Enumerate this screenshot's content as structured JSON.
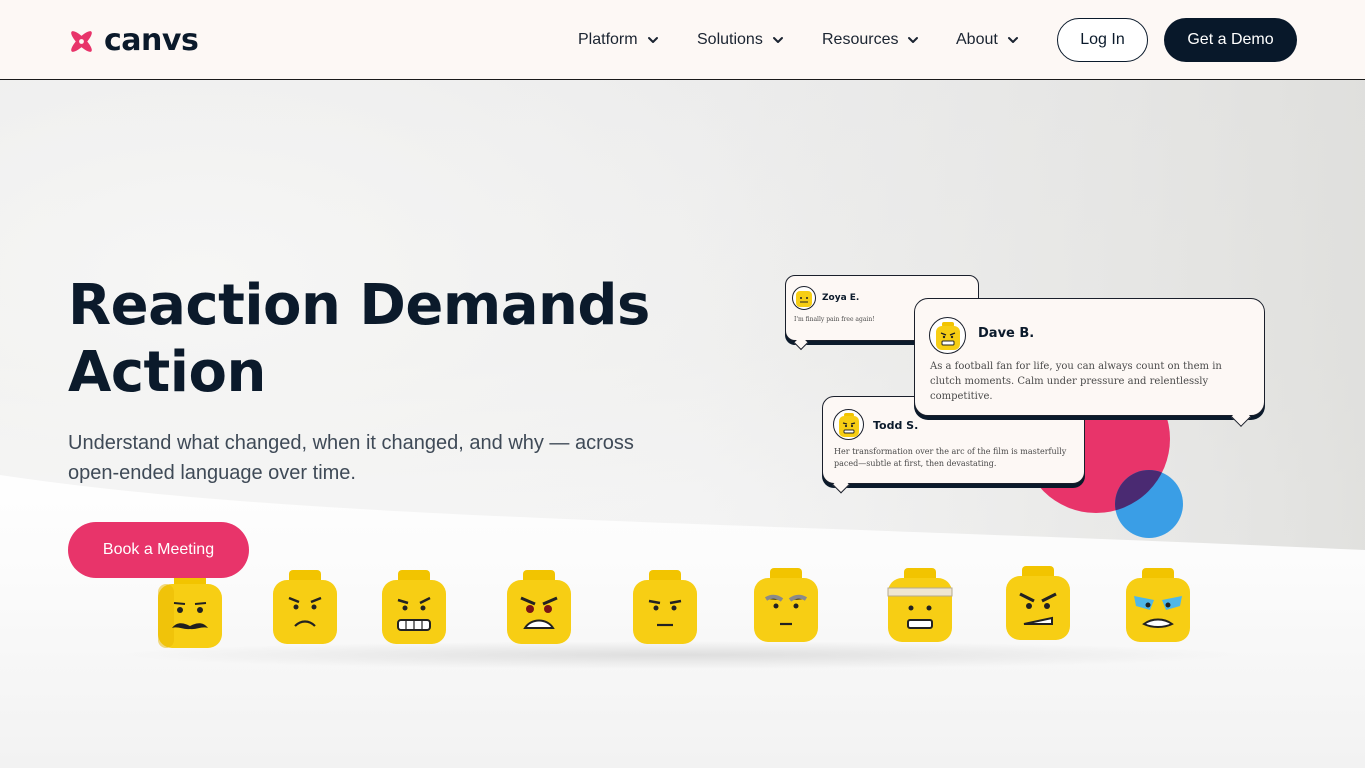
{
  "brand": {
    "name": "canvs",
    "accent": "#e8346a",
    "dark": "#08182a",
    "blue": "#3a9ee6"
  },
  "nav": {
    "items": [
      {
        "label": "Platform",
        "icon": "chevron-down-icon"
      },
      {
        "label": "Solutions",
        "icon": "chevron-down-icon"
      },
      {
        "label": "Resources",
        "icon": "chevron-down-icon"
      },
      {
        "label": "About",
        "icon": "chevron-down-icon"
      }
    ],
    "login_label": "Log In",
    "demo_label": "Get a Demo"
  },
  "hero": {
    "title_line1": "Reaction Demands",
    "title_line2": "Action",
    "subtitle": "Understand what changed, when it changed, and why — across open-ended language over time.",
    "cta_label": "Book a Meeting"
  },
  "testimonials": [
    {
      "name": "Zoya E.",
      "text": "I'm finally pain free again!"
    },
    {
      "name": "Dave B.",
      "text": "As a football fan for life, you can always count on them in clutch moments. Calm under pressure and relentlessly competitive."
    },
    {
      "name": "Todd S.",
      "text": "Her transformation over the arc of the film is masterfully paced—subtle at first, then devastating."
    }
  ]
}
